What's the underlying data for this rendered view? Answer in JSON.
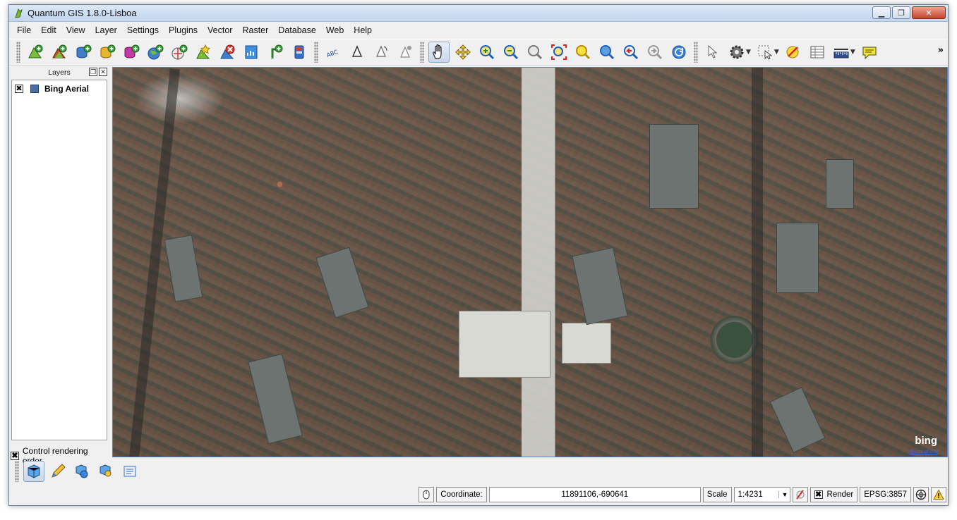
{
  "window": {
    "title": "Quantum GIS 1.8.0-Lisboa"
  },
  "menu": [
    "File",
    "Edit",
    "View",
    "Layer",
    "Settings",
    "Plugins",
    "Vector",
    "Raster",
    "Database",
    "Web",
    "Help"
  ],
  "toolbar": {
    "overflow_label": "»",
    "abc_label": "ABC"
  },
  "layers_panel": {
    "title": "Layers",
    "layers": [
      {
        "name": "Bing Aerial",
        "visible": true
      }
    ],
    "control_rendering_order": {
      "label": "Control rendering order",
      "checked": true
    }
  },
  "map": {
    "attribution_logo": "bing",
    "terms_link": "Terms of Use"
  },
  "statusbar": {
    "coordinate_label": "Coordinate:",
    "coordinate_value": "11891106,-690641",
    "scale_label": "Scale",
    "scale_value": "1:4231",
    "render_label": "Render",
    "render_checked": true,
    "crs": "EPSG:3857"
  }
}
